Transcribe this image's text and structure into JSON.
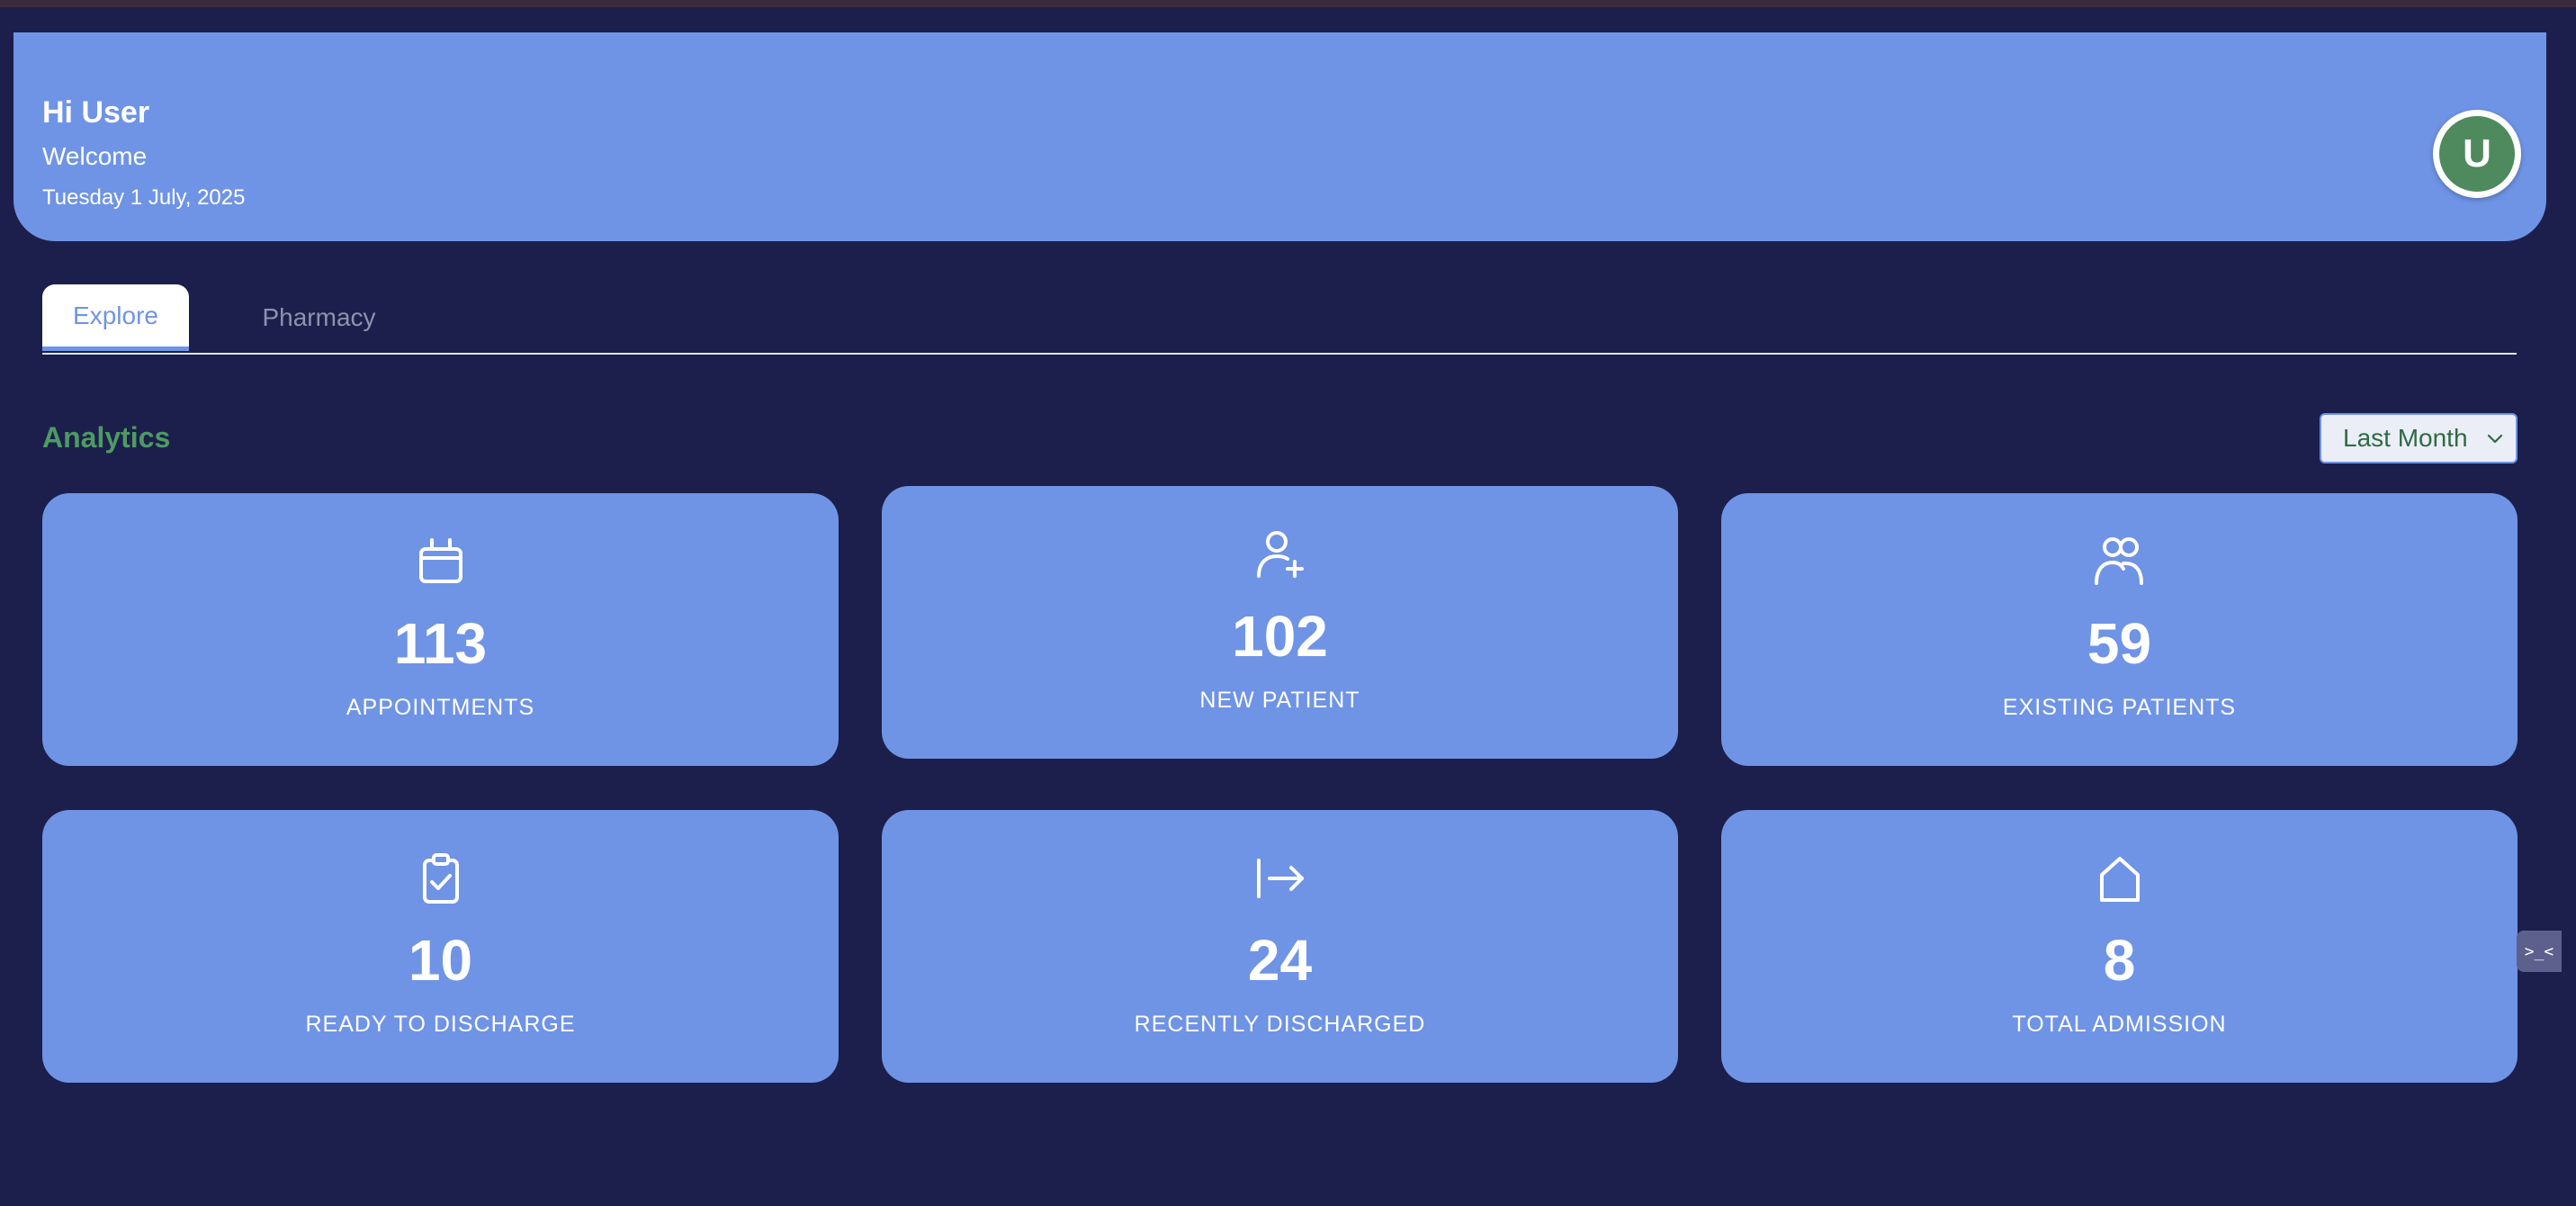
{
  "header": {
    "greeting": "Hi User",
    "welcome": "Welcome",
    "date": "Tuesday 1 July, 2025",
    "avatar_initial": "U"
  },
  "tabs": [
    {
      "label": "Explore",
      "active": true
    },
    {
      "label": "Pharmacy",
      "active": false
    }
  ],
  "analytics": {
    "title": "Analytics",
    "period": {
      "selected": "Last Month"
    }
  },
  "cards": [
    {
      "icon": "calendar-icon",
      "value": "113",
      "label": "APPOINTMENTS"
    },
    {
      "icon": "user-add-icon",
      "value": "102",
      "label": "NEW PATIENT"
    },
    {
      "icon": "users-icon",
      "value": "59",
      "label": "EXISTING PATIENTS"
    },
    {
      "icon": "clipboard-check-icon",
      "value": "10",
      "label": "READY TO DISCHARGE"
    },
    {
      "icon": "arrow-exit-icon",
      "value": "24",
      "label": "RECENTLY DISCHARGED"
    },
    {
      "icon": "house-icon",
      "value": "8",
      "label": "TOTAL ADMISSION"
    }
  ],
  "side_widget": {
    "text": ">_<"
  },
  "colors": {
    "background": "#1c1f4c",
    "card": "#6f94e5",
    "accent_green": "#4e9a63",
    "avatar": "#4e8a5d"
  }
}
